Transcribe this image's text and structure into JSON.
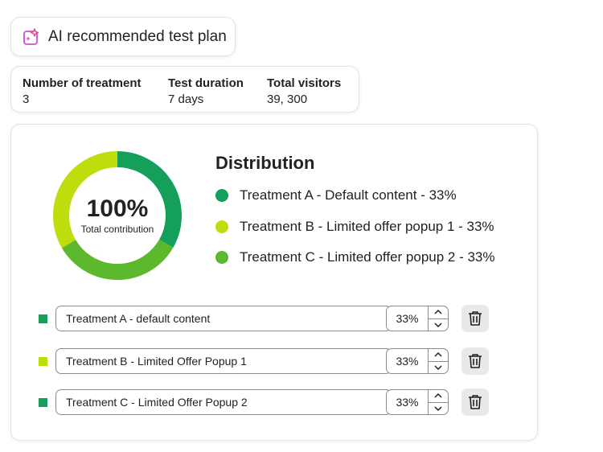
{
  "header": {
    "title": "AI recommended test plan",
    "icon": "ai-sparkle-icon"
  },
  "stats": {
    "treatments_label": "Number of treatment",
    "treatments_value": "3",
    "duration_label": "Test duration",
    "duration_value": "7 days",
    "visitors_label": "Total visitors",
    "visitors_value": "39, 300"
  },
  "donut": {
    "center_value": "100%",
    "center_label": "Total contribution",
    "segments": [
      {
        "share": 0.333,
        "color": "#14a05a"
      },
      {
        "share": 0.333,
        "color": "#5cb82c"
      },
      {
        "share": 0.334,
        "color": "#bfdc0c"
      }
    ]
  },
  "distribution": {
    "title": "Distribution",
    "legend": [
      {
        "label": "Treatment A - Default content - 33%",
        "color": "#14a05a"
      },
      {
        "label": "Treatment B - Limited offer popup 1 - 33%",
        "color": "#bfdc0c"
      },
      {
        "label": "Treatment C - Limited offer popup 2 - 33%",
        "color": "#5cb82c"
      }
    ]
  },
  "treatments": [
    {
      "name": "Treatment A - default content",
      "percent": "33%",
      "color": "#14a05a"
    },
    {
      "name": "Treatment B - Limited Offer Popup 1",
      "percent": "33%",
      "color": "#bfdc0c"
    },
    {
      "name": "Treatment C - Limited Offer Popup 2",
      "percent": "33%",
      "color": "#14a05a"
    }
  ]
}
